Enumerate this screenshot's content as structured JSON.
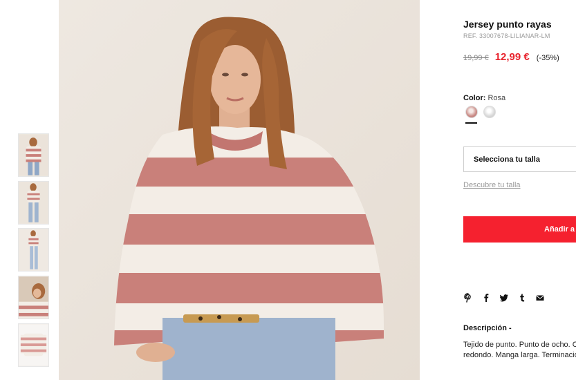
{
  "product": {
    "title": "Jersey punto rayas",
    "reference": "REF. 33007678-LILIANAR-LM",
    "old_price": "19,99 €",
    "sale_price": "12,99 €",
    "discount": "(-35%)",
    "color_label": "Color:",
    "color_value": "Rosa",
    "size_select_label": "Selecciona tu talla",
    "size_guide_label": "Descubre tu talla",
    "add_button_label": "Añadir a",
    "description_title": "Descripción -",
    "description_text": "Tejido de punto. Punto de ocho. Cuello redondo. Manga larga. Terminaciones"
  },
  "colors": {
    "accent_red": "#e8232d",
    "button_red": "#f5212f",
    "stripe_pink": "#c9807a",
    "stripe_cream": "#f3ede6"
  },
  "share_icons": [
    "pinterest-icon",
    "facebook-icon",
    "twitter-icon",
    "tumblr-icon",
    "email-icon"
  ],
  "thumbnails": [
    "thumb-front-full",
    "thumb-front-jeans",
    "thumb-full-body",
    "thumb-detail-closeup",
    "thumb-flat-lay"
  ],
  "swatches": [
    "rosa",
    "gris"
  ]
}
